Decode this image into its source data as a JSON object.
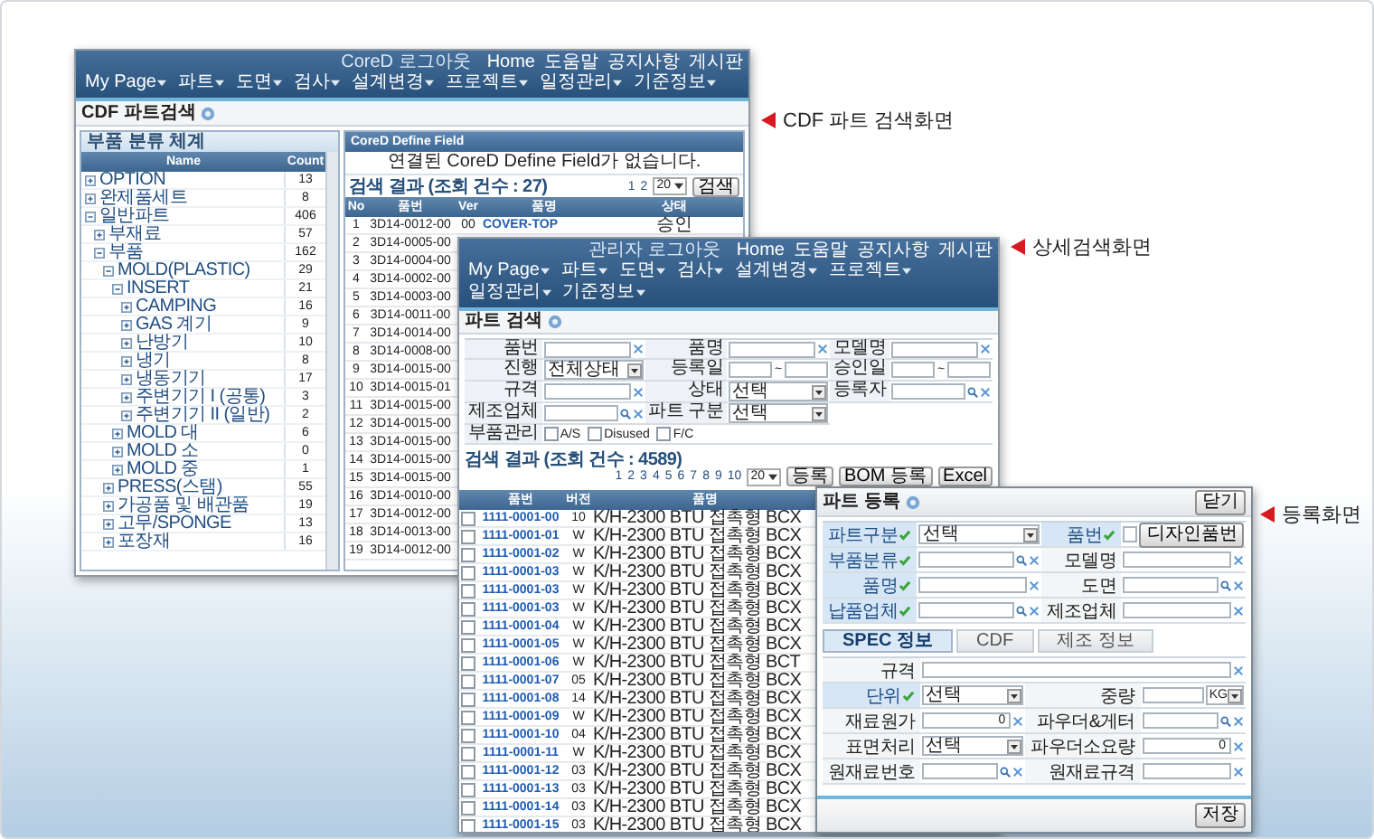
{
  "annotations": [
    {
      "text": "CDF 파트 검색화면"
    },
    {
      "text": "상세검색화면"
    },
    {
      "text": "등록화면"
    }
  ],
  "cdf_window": {
    "user_info": "CoreD 로그아웃",
    "top_links": [
      "Home",
      "도움말",
      "공지사항",
      "게시판"
    ],
    "menu": [
      "My Page",
      "파트",
      "도면",
      "검사",
      "설계변경",
      "프로젝트",
      "일정관리",
      "기준정보"
    ],
    "title": "CDF 파트검색",
    "tree_title": "부품 분류 체계",
    "tree_columns": [
      "Name",
      "Count"
    ],
    "tree": [
      {
        "name": "OPTION",
        "count": "13",
        "expanded": false
      },
      {
        "name": "완제품세트",
        "count": "8",
        "expanded": false
      },
      {
        "name": "일반파트",
        "count": "406",
        "expanded": true,
        "children": [
          {
            "name": "부재료",
            "count": "57",
            "expanded": false
          },
          {
            "name": "부품",
            "count": "162",
            "expanded": true,
            "children": [
              {
                "name": "MOLD(PLASTIC)",
                "count": "29",
                "expanded": true,
                "children": [
                  {
                    "name": "INSERT",
                    "count": "21",
                    "expanded": true,
                    "children": [
                      {
                        "name": "CAMPING",
                        "count": "16",
                        "expanded": false
                      },
                      {
                        "name": "GAS 계기",
                        "count": "9",
                        "expanded": false
                      },
                      {
                        "name": "난방기",
                        "count": "10",
                        "expanded": false
                      },
                      {
                        "name": "냉기",
                        "count": "8",
                        "expanded": false
                      },
                      {
                        "name": "냉동기기",
                        "count": "17",
                        "expanded": false
                      },
                      {
                        "name": "주변기기 I (공통)",
                        "count": "3",
                        "expanded": false
                      },
                      {
                        "name": "주변기기 II (일반)",
                        "count": "2",
                        "expanded": false
                      }
                    ]
                  },
                  {
                    "name": "MOLD 대",
                    "count": "6",
                    "expanded": false
                  },
                  {
                    "name": "MOLD 소",
                    "count": "0",
                    "expanded": false
                  },
                  {
                    "name": "MOLD 중",
                    "count": "1",
                    "expanded": false
                  }
                ]
              },
              {
                "name": "PRESS(스탬)",
                "count": "55",
                "expanded": false
              },
              {
                "name": "가공품 및 배관품",
                "count": "19",
                "expanded": false
              },
              {
                "name": "고무/SPONGE",
                "count": "13",
                "expanded": false
              },
              {
                "name": "포장재",
                "count": "16",
                "expanded": false
              }
            ]
          }
        ]
      }
    ],
    "field_panel": {
      "title": "CoreD Define Field",
      "message": "연결된 CoreD Define Field가 없습니다."
    },
    "results": {
      "summary": "검색 결과 (조회 건수 : 27)",
      "pages": [
        "1",
        "2"
      ],
      "page_size": "20",
      "search_button": "검색",
      "columns": [
        "No",
        "품번",
        "Ver",
        "품명",
        "상태"
      ],
      "rows": [
        {
          "cells": [
            "1",
            "3D14-0012-00",
            "00",
            "COVER-TOP",
            "승인"
          ]
        },
        {
          "cells": [
            "2",
            "3D14-0005-00"
          ]
        },
        {
          "cells": [
            "3",
            "3D14-0004-00"
          ]
        },
        {
          "cells": [
            "4",
            "3D14-0002-00"
          ]
        },
        {
          "cells": [
            "5",
            "3D14-0003-00"
          ]
        },
        {
          "cells": [
            "6",
            "3D14-0011-00"
          ]
        },
        {
          "cells": [
            "7",
            "3D14-0014-00"
          ]
        },
        {
          "cells": [
            "8",
            "3D14-0008-00"
          ]
        },
        {
          "cells": [
            "9",
            "3D14-0015-00"
          ]
        },
        {
          "cells": [
            "10",
            "3D14-0015-01"
          ]
        },
        {
          "cells": [
            "11",
            "3D14-0015-00"
          ]
        },
        {
          "cells": [
            "12",
            "3D14-0015-00"
          ]
        },
        {
          "cells": [
            "13",
            "3D14-0015-00"
          ]
        },
        {
          "cells": [
            "14",
            "3D14-0015-00"
          ]
        },
        {
          "cells": [
            "15",
            "3D14-0015-00"
          ]
        },
        {
          "cells": [
            "16",
            "3D14-0010-00"
          ]
        },
        {
          "cells": [
            "17",
            "3D14-0012-00"
          ]
        },
        {
          "cells": [
            "18",
            "3D14-0013-00"
          ]
        },
        {
          "cells": [
            "19",
            "3D14-0012-00"
          ]
        }
      ]
    }
  },
  "search_window": {
    "user_info": "관리자 로그아웃",
    "top_links": [
      "Home",
      "도움말",
      "공지사항",
      "게시판"
    ],
    "menu": [
      "My Page",
      "파트",
      "도면",
      "검사",
      "설계변경",
      "프로젝트",
      "일정관리",
      "기준정보"
    ],
    "title": "파트 검색",
    "filters": [
      {
        "kind": "text",
        "label": "품번"
      },
      {
        "kind": "text",
        "label": "품명"
      },
      {
        "kind": "text",
        "label": "모델명"
      },
      {
        "kind": "select",
        "label": "진행",
        "value": "전체상태"
      },
      {
        "kind": "date",
        "label": "등록일",
        "separator": "~"
      },
      {
        "kind": "date",
        "label": "승인일",
        "separator": "~"
      },
      {
        "kind": "text",
        "label": "규격"
      },
      {
        "kind": "select",
        "label": "상태",
        "value": "선택"
      },
      {
        "kind": "lookup",
        "label": "등록자"
      },
      {
        "kind": "lookup",
        "label": "제조업체"
      },
      {
        "kind": "select",
        "label": "파트 구분",
        "value": "선택"
      },
      {
        "kind": "checks",
        "label": "부품관리",
        "options": [
          {
            "label": "A/S",
            "checked": false
          },
          {
            "label": "Disused",
            "checked": false
          },
          {
            "label": "F/C",
            "checked": false
          }
        ]
      }
    ],
    "results": {
      "summary": "검색 결과 (조회 건수 : 4589)",
      "pages": [
        "1",
        "2",
        "3",
        "4",
        "5",
        "6",
        "7",
        "8",
        "9",
        "10"
      ],
      "page_size": "20",
      "buttons": [
        "등록",
        "BOM 등록",
        "Excel"
      ],
      "columns": [
        "품번",
        "버전",
        "품명"
      ],
      "rows": [
        {
          "checked": false,
          "cells": [
            "1111-0001-00",
            "10",
            "K/H-2300 BTU 접촉형 BCX"
          ]
        },
        {
          "checked": false,
          "cells": [
            "1111-0001-01",
            "W",
            "K/H-2300 BTU 접촉형 BCX"
          ]
        },
        {
          "checked": false,
          "cells": [
            "1111-0001-02",
            "W",
            "K/H-2300 BTU 접촉형 BCX"
          ]
        },
        {
          "checked": false,
          "cells": [
            "1111-0001-03",
            "W",
            "K/H-2300 BTU 접촉형 BCX"
          ]
        },
        {
          "checked": false,
          "cells": [
            "1111-0001-03",
            "W",
            "K/H-2300 BTU 접촉형 BCX"
          ]
        },
        {
          "checked": false,
          "cells": [
            "1111-0001-03",
            "W",
            "K/H-2300 BTU 접촉형 BCX"
          ]
        },
        {
          "checked": false,
          "cells": [
            "1111-0001-04",
            "W",
            "K/H-2300 BTU 접촉형 BCX"
          ]
        },
        {
          "checked": false,
          "cells": [
            "1111-0001-05",
            "W",
            "K/H-2300 BTU 접촉형 BCX"
          ]
        },
        {
          "checked": false,
          "cells": [
            "1111-0001-06",
            "W",
            "K/H-2300 BTU 접촉형 BCT"
          ]
        },
        {
          "checked": false,
          "cells": [
            "1111-0001-07",
            "05",
            "K/H-2300 BTU 접촉형 BCX"
          ]
        },
        {
          "checked": false,
          "cells": [
            "1111-0001-08",
            "14",
            "K/H-2300 BTU 접촉형 BCX"
          ]
        },
        {
          "checked": false,
          "cells": [
            "1111-0001-09",
            "W",
            "K/H-2300 BTU 접촉형 BCX"
          ]
        },
        {
          "checked": false,
          "cells": [
            "1111-0001-10",
            "04",
            "K/H-2300 BTU 접촉형 BCX"
          ]
        },
        {
          "checked": false,
          "cells": [
            "1111-0001-11",
            "W",
            "K/H-2300 BTU 접촉형 BCX"
          ]
        },
        {
          "checked": false,
          "cells": [
            "1111-0001-12",
            "03",
            "K/H-2300 BTU 접촉형 BCX"
          ]
        },
        {
          "checked": false,
          "cells": [
            "1111-0001-13",
            "03",
            "K/H-2300 BTU 접촉형 BCX"
          ]
        },
        {
          "checked": false,
          "cells": [
            "1111-0001-14",
            "03",
            "K/H-2300 BTU 접촉형 BCX"
          ]
        },
        {
          "checked": false,
          "cells": [
            "1111-0001-15",
            "03",
            "K/H-2300 BTU 접촉형 BCX"
          ]
        }
      ]
    }
  },
  "register_window": {
    "title": "파트 등록",
    "close_button": "닫기",
    "fields": [
      {
        "kind": "select",
        "label": "파트구분",
        "required": true,
        "value": "선택"
      },
      {
        "kind": "text_button",
        "label": "품번",
        "required": true,
        "button": "디자인품번"
      },
      {
        "kind": "lookup",
        "label": "부품분류",
        "required": true
      },
      {
        "kind": "text",
        "label": "모델명",
        "required": false
      },
      {
        "kind": "text",
        "label": "품명",
        "required": true
      },
      {
        "kind": "lookup",
        "label": "도면",
        "required": false
      },
      {
        "kind": "lookup",
        "label": "납품업체",
        "required": true
      },
      {
        "kind": "text",
        "label": "제조업체",
        "required": false
      }
    ],
    "tabs": [
      {
        "label": "SPEC 정보",
        "selected": true
      },
      {
        "label": "CDF",
        "selected": false
      },
      {
        "label": "제조 정보",
        "selected": false
      }
    ],
    "spec_fields": [
      {
        "kind": "wide_text",
        "label": "규격",
        "required": false
      },
      {
        "kind": "select",
        "label": "단위",
        "required": true,
        "value": "선택"
      },
      {
        "kind": "unit",
        "label": "중량",
        "required": false,
        "unit": "KG"
      },
      {
        "kind": "number",
        "label": "재료원가",
        "required": false,
        "value": "0"
      },
      {
        "kind": "lookup",
        "label": "파우더&게터",
        "required": false
      },
      {
        "kind": "select",
        "label": "표면처리",
        "required": false,
        "value": "선택"
      },
      {
        "kind": "number",
        "label": "파우더소요량",
        "required": false,
        "value": "0"
      },
      {
        "kind": "lookup",
        "label": "원재료번호",
        "required": false
      },
      {
        "kind": "text",
        "label": "원재료규격",
        "required": false
      }
    ],
    "save_button": "저장"
  }
}
